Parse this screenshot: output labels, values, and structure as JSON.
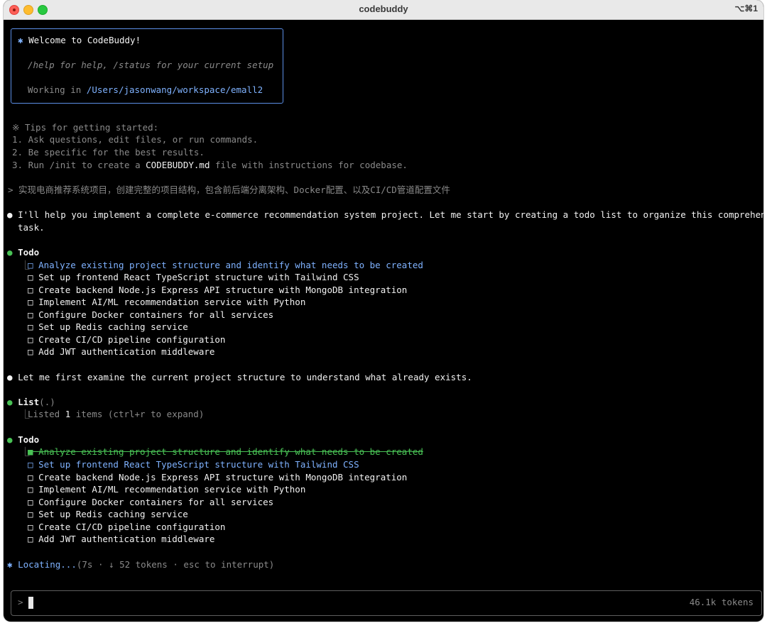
{
  "window": {
    "title": "codebuddy",
    "shortcut": "⌥⌘1"
  },
  "welcome": {
    "star": "✱",
    "title": "Welcome to CodeBuddy!",
    "help_text": "/help for help, /status for your current setup",
    "working_label": "Working in ",
    "working_path": "/Users/jasonwang/workspace/emall2"
  },
  "tips": {
    "header": "※ Tips for getting started:",
    "items": [
      "1. Ask questions, edit files, or run commands.",
      "2. Be specific for the best results."
    ],
    "item3_prefix": "3. Run /init to create a ",
    "item3_file": "CODEBUDDY.md",
    "item3_suffix": " file with instructions for codebase."
  },
  "user_prompt": "> 实现电商推荐系统项目，创建完整的项目结构，包含前后端分离架构、Docker配置、以及CI/CD管道配置文件",
  "messages": {
    "bullet": "●",
    "intro_line1": "I'll help you implement a complete e-commerce recommendation system project. Let me start by creating a todo list to organize this comprehensive",
    "intro_line2": "task.",
    "examine": "Let me first examine the current project structure to understand what already exists."
  },
  "todo_label": "Todo",
  "todo1": {
    "items": [
      "Analyze existing project structure and identify what needs to be created",
      "Set up frontend React TypeScript structure with Tailwind CSS",
      "Create backend Node.js Express API structure with MongoDB integration",
      "Implement AI/ML recommendation service with Python",
      "Configure Docker containers for all services",
      "Set up Redis caching service",
      "Create CI/CD pipeline configuration",
      "Add JWT authentication middleware"
    ]
  },
  "list_tool": {
    "name": "List",
    "arg": "(.)",
    "result_prefix": "Listed ",
    "count": "1",
    "result_suffix": " items (ctrl+r to expand)"
  },
  "todo2": {
    "items": [
      "Analyze existing project structure and identify what needs to be created",
      "Set up frontend React TypeScript structure with Tailwind CSS",
      "Create backend Node.js Express API structure with MongoDB integration",
      "Implement AI/ML recommendation service with Python",
      "Configure Docker containers for all services",
      "Set up Redis caching service",
      "Create CI/CD pipeline configuration",
      "Add JWT authentication middleware"
    ]
  },
  "status": {
    "star": "✱",
    "word": "Locating...",
    "detail": "(7s · ↓ 52 tokens · esc to interrupt)"
  },
  "input": {
    "prompt": ">",
    "tokens": "46.1k tokens"
  },
  "glyphs": {
    "tree": "⎿",
    "unchecked": "□",
    "checked": "■"
  },
  "colors": {
    "accent_blue": "#7fb2ff",
    "success_green": "#49c255",
    "box_border": "#5b8ee6"
  }
}
